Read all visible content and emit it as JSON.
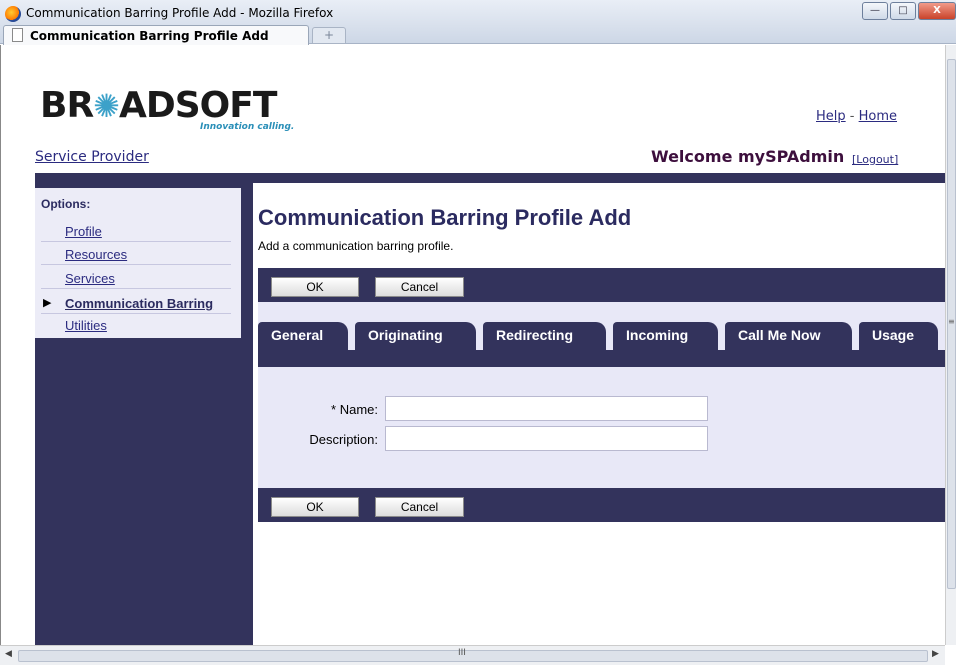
{
  "window": {
    "title": "Communication Barring Profile Add - Mozilla Firefox",
    "tab_label": "Communication Barring Profile Add",
    "new_tab_symbol": "+",
    "buttons": {
      "minimize": "—",
      "maximize": "□",
      "close": "X"
    }
  },
  "header": {
    "logo": "BROADSOFT",
    "tagline": "Innovation calling.",
    "help_link": "Help",
    "separator": "-",
    "home_link": "Home",
    "service_provider_link": "Service Provider",
    "welcome": "Welcome mySPAdmin",
    "logout_link": "[Logout]"
  },
  "sidebar": {
    "options_title": "Options:",
    "items": [
      {
        "label": "Profile",
        "active": false
      },
      {
        "label": "Resources",
        "active": false
      },
      {
        "label": "Services",
        "active": false
      },
      {
        "label": "Communication Barring",
        "active": true
      },
      {
        "label": "Utilities",
        "active": false
      }
    ]
  },
  "main": {
    "title": "Communication Barring Profile Add",
    "subtitle": "Add a communication barring profile.",
    "ok_label": "OK",
    "cancel_label": "Cancel",
    "tabs": [
      {
        "label": "General",
        "selected": true
      },
      {
        "label": "Originating",
        "selected": false
      },
      {
        "label": "Redirecting",
        "selected": false
      },
      {
        "label": "Incoming",
        "selected": false
      },
      {
        "label": "Call Me Now",
        "selected": false
      },
      {
        "label": "Usage",
        "selected": false
      }
    ],
    "form": {
      "name_label": "* Name:",
      "name_value": "",
      "description_label": "Description:",
      "description_value": ""
    }
  },
  "scrollbar": {
    "grip": "III"
  },
  "colors": {
    "nav_dark": "#33335c",
    "panel_light": "#e8e8f7",
    "link": "#2b2b80",
    "welcome": "#3d0f3d",
    "accent_cyan": "#2a8fb8"
  }
}
